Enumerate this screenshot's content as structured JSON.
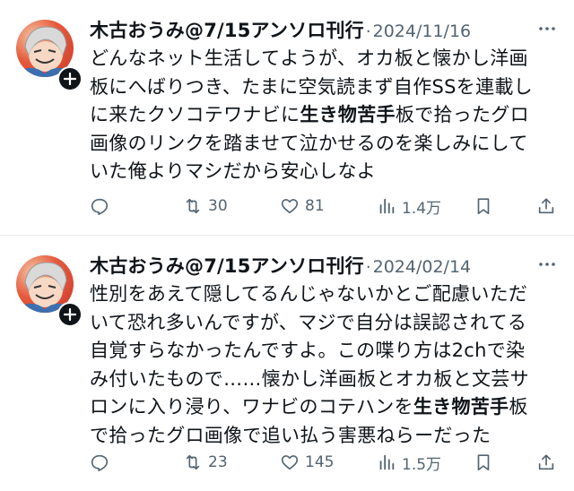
{
  "tweets": [
    {
      "author": "木古おうみ@7/15アンソロ刊行",
      "separator": "·",
      "date": "2024/11/16",
      "lines": [
        {
          "pre": "どんなネット生活してようが、オカ板と懐かし洋画",
          "hl": "",
          "post": ""
        },
        {
          "pre": "板にへばりつき、たまに空気読まず自作SSを連載し",
          "hl": "",
          "post": ""
        },
        {
          "pre": "に来たクソコテワナビに",
          "hl": "生き物苦手",
          "post": "板で拾ったグロ"
        },
        {
          "pre": "画像のリンクを踏ませて泣かせるのを楽しみにして",
          "hl": "",
          "post": ""
        },
        {
          "pre": "いた俺よりマシだから安心しなよ",
          "hl": "",
          "post": ""
        }
      ],
      "stats": {
        "retweets": "30",
        "likes": "81",
        "views": "1.4万"
      }
    },
    {
      "author": "木古おうみ@7/15アンソロ刊行",
      "separator": "·",
      "date": "2024/02/14",
      "lines": [
        {
          "pre": "性別をあえて隠してるんじゃないかとご配慮いただ",
          "hl": "",
          "post": ""
        },
        {
          "pre": "いて恐れ多いんですが、マジで自分は誤認されてる",
          "hl": "",
          "post": ""
        },
        {
          "pre": "自覚すらなかったんですよ。この喋り方は2chで染",
          "hl": "",
          "post": ""
        },
        {
          "pre": "み付いたもので……懐かし洋画板とオカ板と文芸サ",
          "hl": "",
          "post": ""
        },
        {
          "pre": "ロンに入り浸り、ワナビのコテハンを",
          "hl": "生き物苦手",
          "post": "板"
        },
        {
          "pre": "で拾ったグロ画像で追い払う害悪ねらーだった",
          "hl": "",
          "post": ""
        }
      ],
      "stats": {
        "retweets": "23",
        "likes": "145",
        "views": "1.5万"
      }
    }
  ],
  "icons": {
    "reply": "reply-icon",
    "retweet": "retweet-icon",
    "like": "heart-icon",
    "views": "views-icon",
    "bookmark": "bookmark-icon",
    "share": "share-icon",
    "more": "more-icon",
    "follow": "plus-icon"
  },
  "colors": {
    "text": "#0f1419",
    "muted": "#536471",
    "divider": "#e6e9ec"
  }
}
